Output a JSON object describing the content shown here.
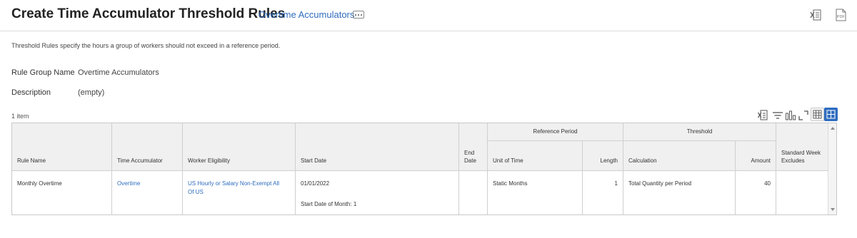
{
  "header": {
    "title": "Create Time Accumulator Threshold Rules",
    "related_link": "Overtime Accumulators",
    "actions_icon": "ellipsis-icon",
    "export_excel_icon": "excel-export-icon",
    "export_pdf_icon": "pdf-export-icon",
    "pdf_label": "PDF"
  },
  "intro_text": "Threshold Rules specify the hours a group of workers should not exceed in a reference period.",
  "fields": {
    "rule_group_name": {
      "label": "Rule Group Name",
      "value": "Overtime Accumulators"
    },
    "description": {
      "label": "Description",
      "value": "(empty)"
    }
  },
  "grid": {
    "item_count": "1 item",
    "tools": [
      "excel-export-icon",
      "filter-icon",
      "chart-icon",
      "expand-icon",
      "table-view-icon",
      "grid-view-icon"
    ],
    "group_headers": {
      "reference_period": "Reference Period",
      "threshold": "Threshold"
    },
    "columns": {
      "rule_name": "Rule Name",
      "time_accumulator": "Time Accumulator",
      "worker_eligibility": "Worker Eligibility",
      "start_date": "Start Date",
      "end_date_line1": "End",
      "end_date_line2": "Date",
      "unit_of_time": "Unit of Time",
      "length": "Length",
      "calculation": "Calculation",
      "amount": "Amount",
      "standard_week_excludes_line1": "Standard Week",
      "standard_week_excludes_line2": "Excludes"
    },
    "rows": [
      {
        "rule_name": "Monthly Overtime",
        "time_accumulator": "Overtime",
        "worker_eligibility_line1": "US Hourly or Salary Non-Exempt All",
        "worker_eligibility_line2": "Of US",
        "start_date": "01/01/2022",
        "start_date_detail": "Start Date of Month: 1",
        "end_date": "",
        "unit_of_time": "Static Months",
        "length": "1",
        "calculation": "Total Quantity per Period",
        "amount": "40",
        "standard_week_excludes": ""
      }
    ]
  },
  "colors": {
    "link": "#2f6dbf",
    "header_bg": "#f0f0f0",
    "border": "#cfcfcf",
    "active_view": "#2f6dbf"
  }
}
